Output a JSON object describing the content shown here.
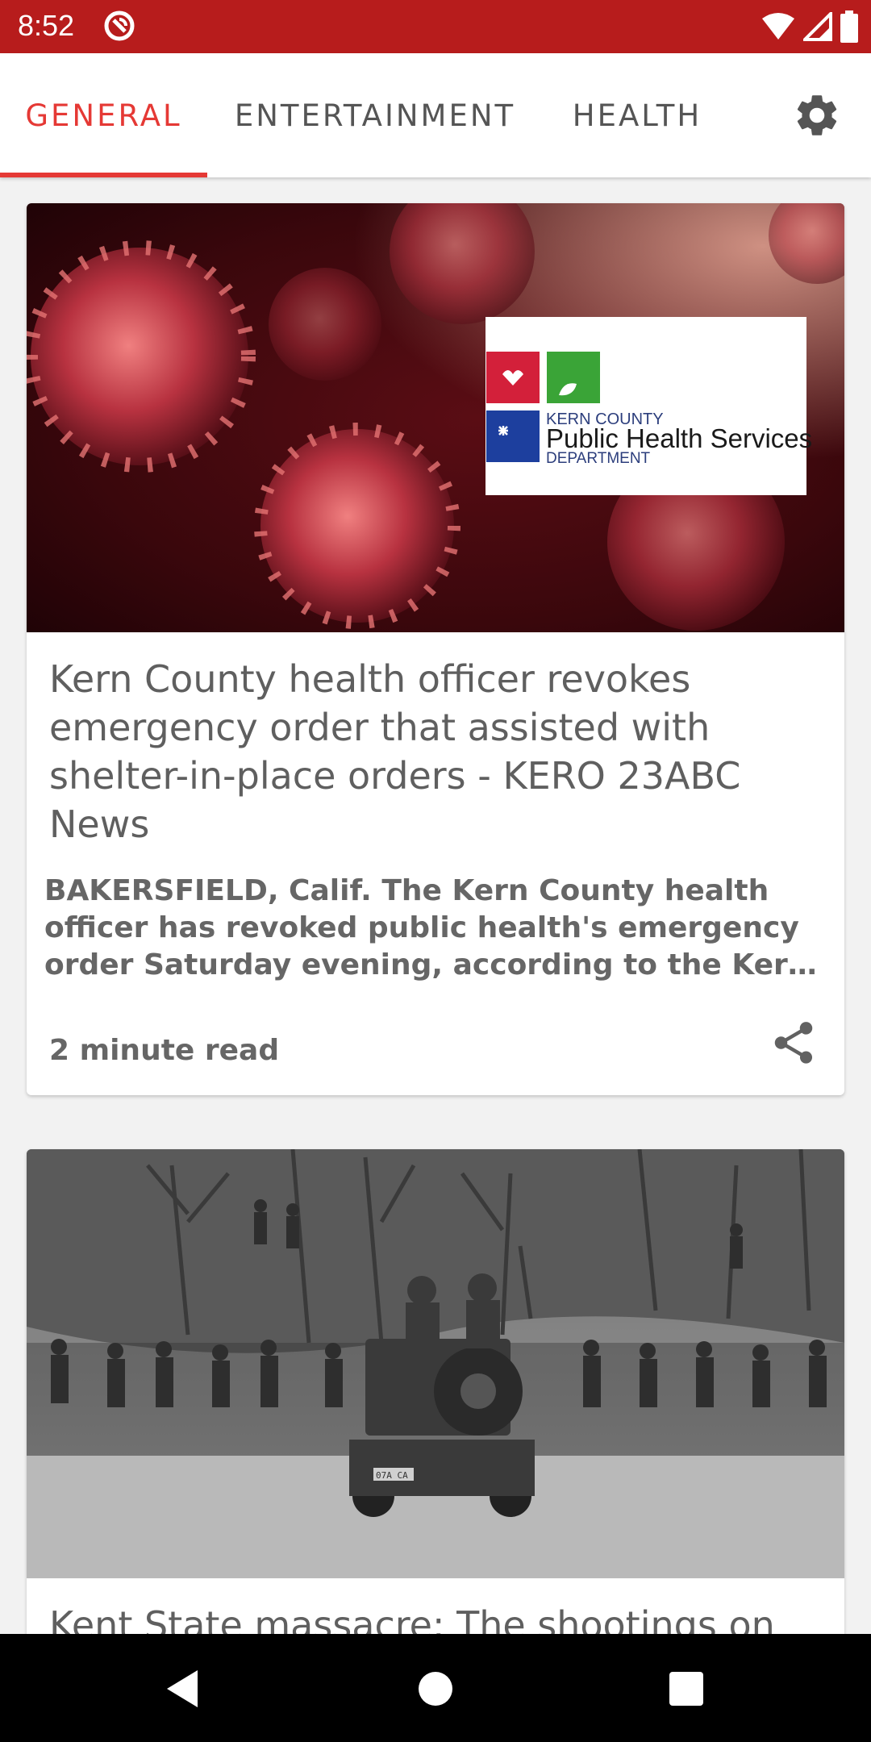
{
  "status_bar": {
    "time": "8:52"
  },
  "tabs": [
    {
      "label": "GENERAL",
      "active": true
    },
    {
      "label": "ENTERTAINMENT",
      "active": false
    },
    {
      "label": "HEALTH",
      "active": false
    }
  ],
  "articles": [
    {
      "image_logo": {
        "line1": "KERN COUNTY",
        "line2": "Public Health Services",
        "line3": "DEPARTMENT"
      },
      "title": "Kern County health officer revokes emergency order that assisted with shelter-in-place orders - KERO 23ABC News",
      "description": "BAKERSFIELD, Calif. The Kern County health officer has revoked public health's emergency order Saturday evening, according to the Kern County Public Health Services Department.",
      "read_time": "2 minute read"
    },
    {
      "image_label": "07A CA",
      "title": "Kent State massacre: The shootings on"
    }
  ],
  "colors": {
    "accent": "#e53935",
    "status_bar": "#b71c1c"
  }
}
